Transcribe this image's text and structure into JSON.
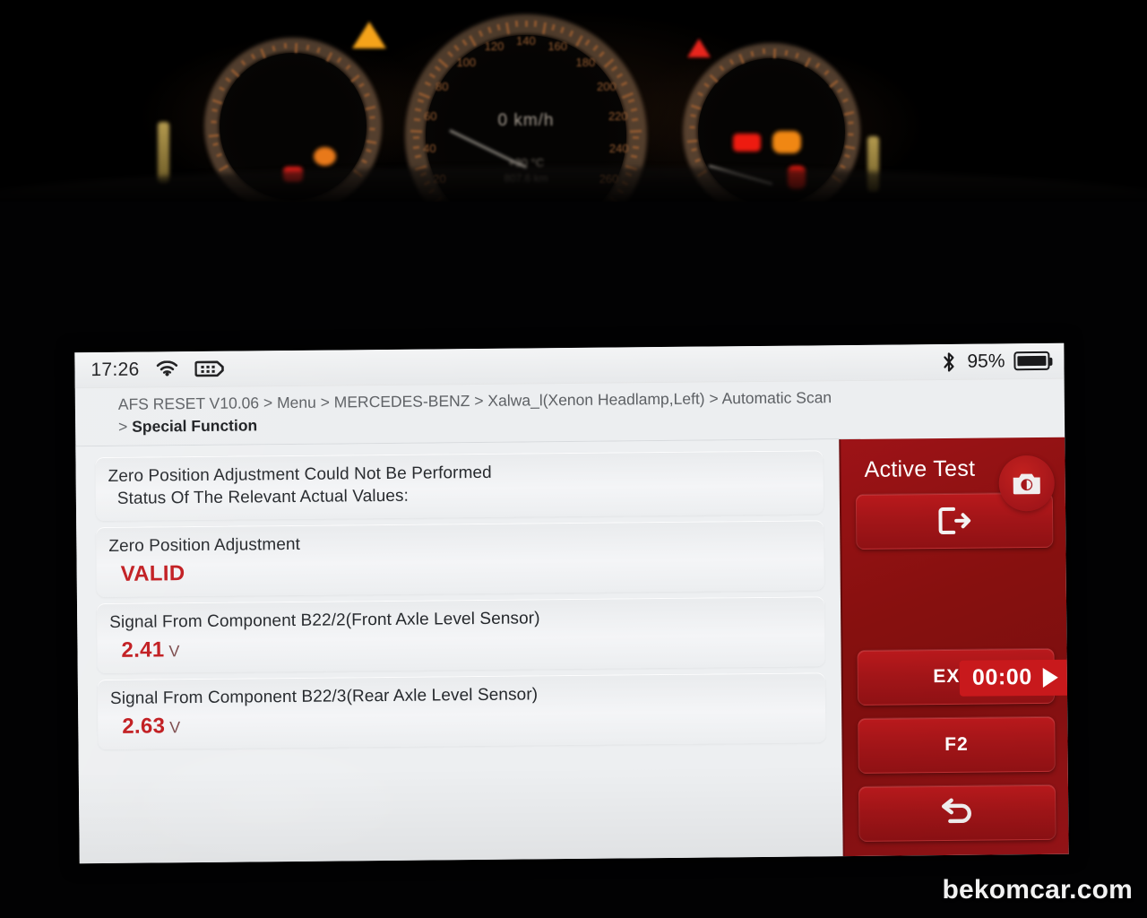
{
  "statusbar": {
    "time": "17:26",
    "wifi_icon": "wifi-icon",
    "vci_icon": "vci-connector-icon",
    "bluetooth_icon": "bluetooth-icon",
    "battery_percent": "95%",
    "battery_icon": "battery-icon"
  },
  "breadcrumb": {
    "full": "AFS RESET V10.06 > Menu > MERCEDES-BENZ > Xalwa_l(Xenon Headlamp,Left) > Automatic Scan > ",
    "last": "Special Function"
  },
  "content": {
    "rows": [
      {
        "line1": "Zero Position Adjustment Could Not Be Performed",
        "line2": "Status Of The Relevant Actual Values:",
        "value": "",
        "unit": ""
      },
      {
        "line1": "Zero Position Adjustment",
        "line2": "",
        "value": "VALID",
        "unit": ""
      },
      {
        "line1": "Signal From Component B22/2(Front Axle Level Sensor)",
        "line2": "",
        "value": "2.41",
        "unit": "V"
      },
      {
        "line1": "Signal From Component B22/3(Rear Axle Level Sensor)",
        "line2": "",
        "value": "2.63",
        "unit": "V"
      }
    ]
  },
  "panel": {
    "title": "Active Test",
    "camera_icon": "camera-icon",
    "exit_icon_button": "exit-arrow-icon",
    "timer": "00:00",
    "play_icon": "play-icon",
    "buttons": [
      {
        "label": "EXIT"
      },
      {
        "label": "F2"
      }
    ],
    "back_icon": "back-arrow-icon",
    "accent_color": "#9d1317",
    "accent_bright": "#c8191c"
  },
  "cluster": {
    "speed": "0 km/h",
    "temperature": "+30 °C",
    "odometer": "807.6 km",
    "warning_amber_icon": "warning-triangle-amber-icon",
    "warning_red_icon": "warning-triangle-red-icon",
    "speedo_labels": [
      "20",
      "40",
      "60",
      "80",
      "100",
      "120",
      "140",
      "160",
      "180",
      "200",
      "220",
      "240",
      "260"
    ]
  },
  "watermark": {
    "text": "bekomcar.com"
  },
  "theme": {
    "screen_bg": "#edeff1",
    "value_red": "#c11b1f",
    "text_dark": "#25282c",
    "breadcrumb_gray": "#5d6064"
  }
}
